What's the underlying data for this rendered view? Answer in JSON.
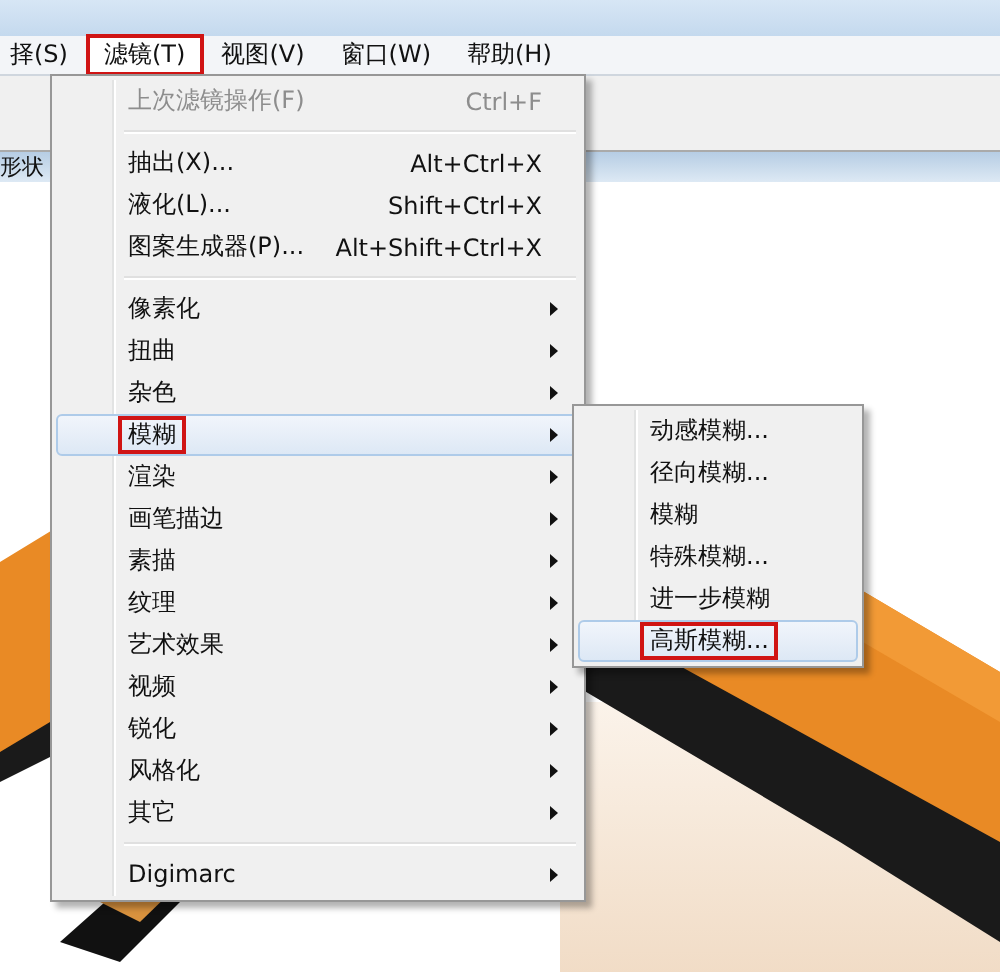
{
  "menubar": [
    {
      "label": "择(S)",
      "selected": false,
      "annotated": false
    },
    {
      "label": "滤镜(T)",
      "selected": true,
      "annotated": true
    },
    {
      "label": "视图(V)",
      "selected": false,
      "annotated": false
    },
    {
      "label": "窗口(W)",
      "selected": false,
      "annotated": false
    },
    {
      "label": "帮助(H)",
      "selected": false,
      "annotated": false
    }
  ],
  "document_tab": {
    "label": "形状"
  },
  "filter_menu": {
    "items": [
      {
        "kind": "item",
        "label": "上次滤镜操作(F)",
        "shortcut": "Ctrl+F",
        "disabled": true,
        "selected": false,
        "annotated": false
      },
      {
        "kind": "separator"
      },
      {
        "kind": "item",
        "label": "抽出(X)...",
        "shortcut": "Alt+Ctrl+X",
        "disabled": false,
        "selected": false,
        "annotated": false
      },
      {
        "kind": "item",
        "label": "液化(L)...",
        "shortcut": "Shift+Ctrl+X",
        "disabled": false,
        "selected": false,
        "annotated": false
      },
      {
        "kind": "item",
        "label": "图案生成器(P)...",
        "shortcut": "Alt+Shift+Ctrl+X",
        "disabled": false,
        "selected": false,
        "annotated": false
      },
      {
        "kind": "separator"
      },
      {
        "kind": "submenu",
        "label": "像素化",
        "disabled": false,
        "selected": false,
        "annotated": false
      },
      {
        "kind": "submenu",
        "label": "扭曲",
        "disabled": false,
        "selected": false,
        "annotated": false
      },
      {
        "kind": "submenu",
        "label": "杂色",
        "disabled": false,
        "selected": false,
        "annotated": false
      },
      {
        "kind": "submenu",
        "label": "模糊",
        "disabled": false,
        "selected": true,
        "annotated": true
      },
      {
        "kind": "submenu",
        "label": "渲染",
        "disabled": false,
        "selected": false,
        "annotated": false
      },
      {
        "kind": "submenu",
        "label": "画笔描边",
        "disabled": false,
        "selected": false,
        "annotated": false
      },
      {
        "kind": "submenu",
        "label": "素描",
        "disabled": false,
        "selected": false,
        "annotated": false
      },
      {
        "kind": "submenu",
        "label": "纹理",
        "disabled": false,
        "selected": false,
        "annotated": false
      },
      {
        "kind": "submenu",
        "label": "艺术效果",
        "disabled": false,
        "selected": false,
        "annotated": false
      },
      {
        "kind": "submenu",
        "label": "视频",
        "disabled": false,
        "selected": false,
        "annotated": false
      },
      {
        "kind": "submenu",
        "label": "锐化",
        "disabled": false,
        "selected": false,
        "annotated": false
      },
      {
        "kind": "submenu",
        "label": "风格化",
        "disabled": false,
        "selected": false,
        "annotated": false
      },
      {
        "kind": "submenu",
        "label": "其它",
        "disabled": false,
        "selected": false,
        "annotated": false
      },
      {
        "kind": "separator"
      },
      {
        "kind": "submenu",
        "label": "Digimarc",
        "disabled": false,
        "selected": false,
        "annotated": false
      }
    ]
  },
  "blur_submenu": {
    "items": [
      {
        "label": "动感模糊...",
        "selected": false,
        "annotated": false
      },
      {
        "label": "径向模糊...",
        "selected": false,
        "annotated": false
      },
      {
        "label": "模糊",
        "selected": false,
        "annotated": false
      },
      {
        "label": "特殊模糊...",
        "selected": false,
        "annotated": false
      },
      {
        "label": "进一步模糊",
        "selected": false,
        "annotated": false
      },
      {
        "label": "高斯模糊...",
        "selected": true,
        "annotated": true
      }
    ]
  }
}
